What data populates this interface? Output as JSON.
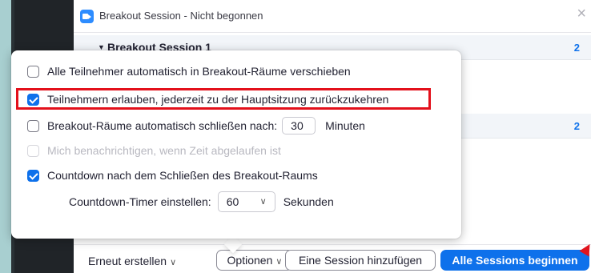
{
  "window": {
    "title": "Breakout Session - Nicht begonnen",
    "close_icon": "×"
  },
  "sessions": [
    {
      "name": "Breakout Session 1",
      "count": "2"
    },
    {
      "name": "",
      "count": "2"
    }
  ],
  "options_popup": {
    "items": [
      {
        "label": "Alle Teilnehmer automatisch in Breakout-Räume verschieben",
        "checked": false,
        "disabled": false
      },
      {
        "label": "Teilnehmern erlauben, jederzeit zu der Hauptsitzung zurückzukehren",
        "checked": true,
        "disabled": false
      },
      {
        "label": "Breakout-Räume automatisch schließen nach:",
        "checked": false,
        "disabled": false,
        "value": "30",
        "unit": "Minuten"
      },
      {
        "label": "Mich benachrichtigen, wenn Zeit abgelaufen ist",
        "checked": false,
        "disabled": true
      },
      {
        "label": "Countdown nach dem Schließen des Breakout-Raums",
        "checked": true,
        "disabled": false
      }
    ],
    "countdown": {
      "label": "Countdown-Timer einstellen:",
      "value": "60",
      "unit": "Sekunden"
    }
  },
  "footer": {
    "recreate_label": "Erneut erstellen",
    "options_label": "Optionen",
    "add_session_label": "Eine Session hinzufügen",
    "start_all_label": "Alle Sessions beginnen"
  },
  "colors": {
    "accent": "#0e71eb",
    "highlight": "#e3101b"
  }
}
